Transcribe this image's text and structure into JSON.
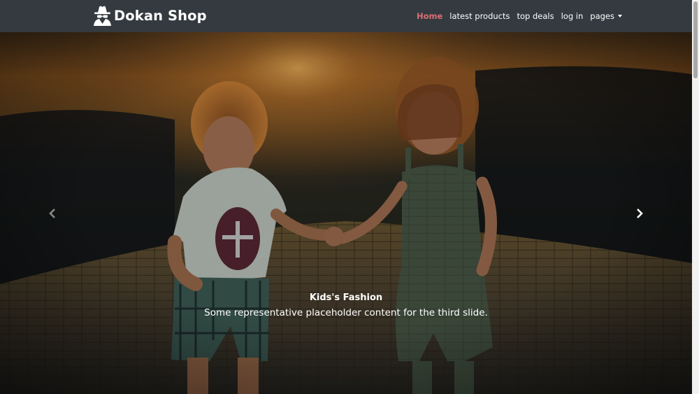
{
  "brand": {
    "name": "Dokan Shop",
    "icon": "spy-icon"
  },
  "nav": {
    "items": [
      {
        "label": "Home",
        "active": true
      },
      {
        "label": "latest products",
        "active": false
      },
      {
        "label": "top deals",
        "active": false
      },
      {
        "label": "log in",
        "active": false
      },
      {
        "label": "pages",
        "active": false,
        "dropdown": true
      }
    ]
  },
  "carousel": {
    "caption_title": "Kids's Fashion",
    "caption_text": "Some representative placeholder content for the third slide.",
    "prev_icon": "chevron-left-icon",
    "next_icon": "chevron-right-icon"
  },
  "colors": {
    "navbar_bg": "#343a40",
    "active_link": "#dc6e72",
    "link": "#ffffff"
  }
}
